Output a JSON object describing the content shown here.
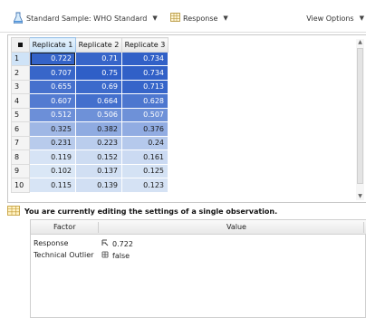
{
  "toolbar": {
    "sample_label": "Standard Sample: WHO Standard",
    "response_label": "Response",
    "view_options_label": "View Options"
  },
  "grid": {
    "columns": [
      "Replicate 1",
      "Replicate 2",
      "Replicate 3"
    ],
    "rows": [
      {
        "label": "1",
        "values": [
          "0.722",
          "0.71",
          "0.734"
        ]
      },
      {
        "label": "2",
        "values": [
          "0.707",
          "0.75",
          "0.734"
        ]
      },
      {
        "label": "3",
        "values": [
          "0.655",
          "0.69",
          "0.713"
        ]
      },
      {
        "label": "4",
        "values": [
          "0.607",
          "0.664",
          "0.628"
        ]
      },
      {
        "label": "5",
        "values": [
          "0.512",
          "0.506",
          "0.507"
        ]
      },
      {
        "label": "6",
        "values": [
          "0.325",
          "0.382",
          "0.376"
        ]
      },
      {
        "label": "7",
        "values": [
          "0.231",
          "0.223",
          "0.24"
        ]
      },
      {
        "label": "8",
        "values": [
          "0.119",
          "0.152",
          "0.161"
        ]
      },
      {
        "label": "9",
        "values": [
          "0.102",
          "0.137",
          "0.125"
        ]
      },
      {
        "label": "10",
        "values": [
          "0.115",
          "0.139",
          "0.123"
        ]
      }
    ],
    "heat_low": "#dbe7f6",
    "heat_high": "#2f5fc7"
  },
  "banner": {
    "text": "You are currently editing the settings of a single observation."
  },
  "settings": {
    "headers": {
      "factor": "Factor",
      "value": "Value"
    },
    "rows": [
      {
        "factor": "Response",
        "value": "0.722",
        "icon": "numeric-icon"
      },
      {
        "factor": "Technical Outlier",
        "value": "false",
        "icon": "boolean-icon"
      }
    ]
  }
}
